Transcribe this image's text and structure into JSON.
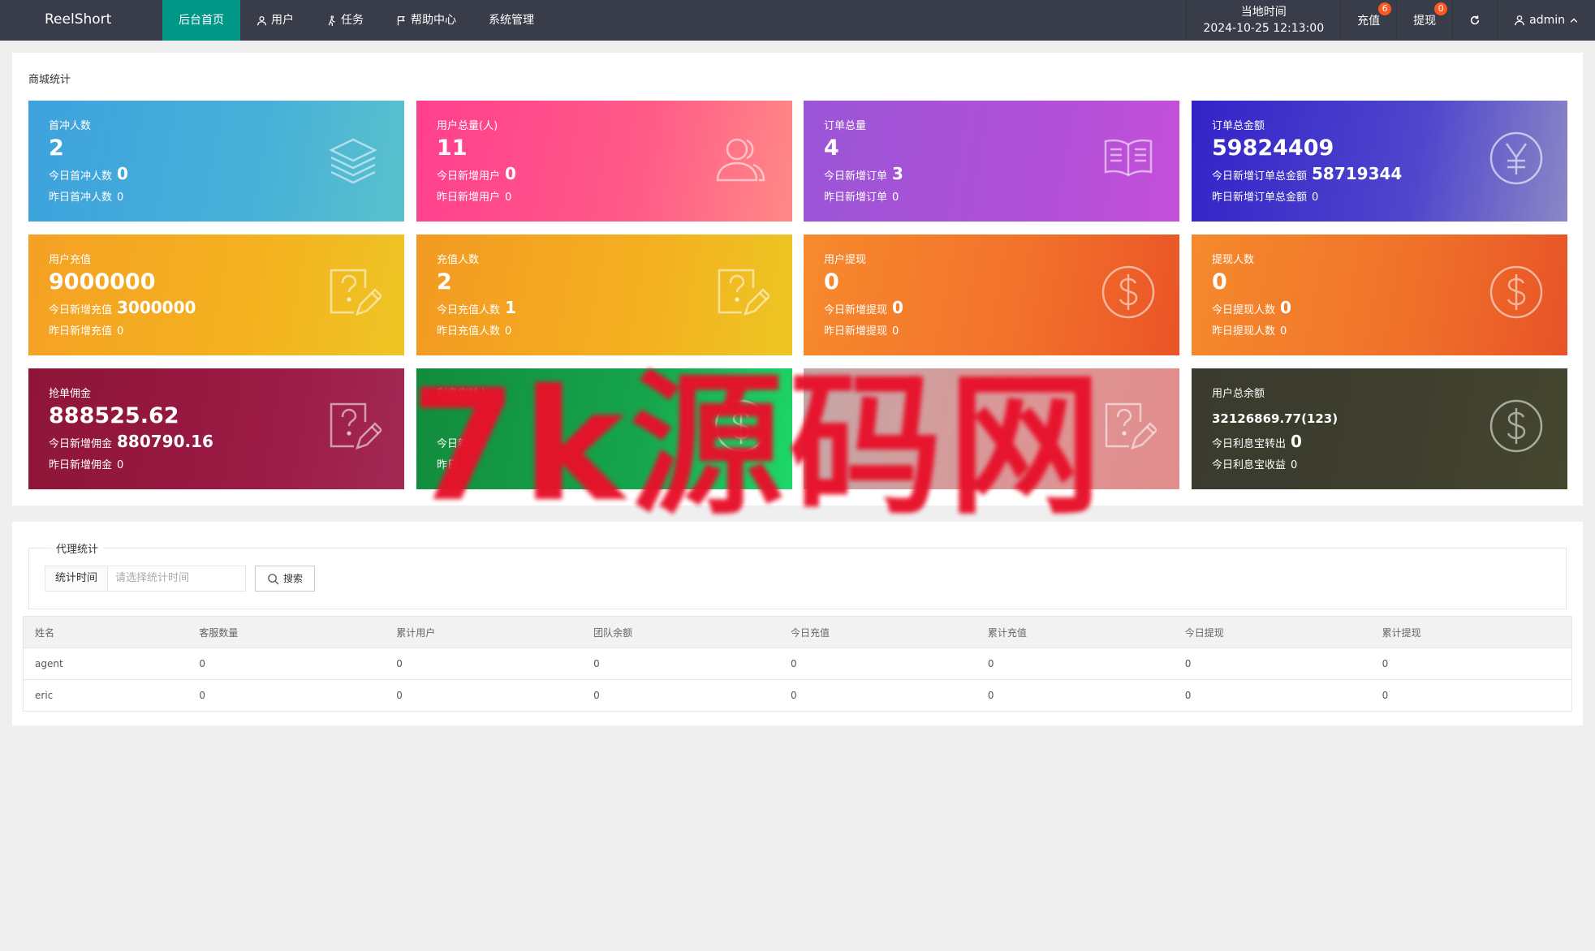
{
  "topbar": {
    "logo": "ReelShort",
    "nav": [
      "后台首页",
      "用户",
      "任务",
      "帮助中心",
      "系统管理"
    ],
    "time_label": "当地时间",
    "time_value": "2024-10-25 12:13:00",
    "recharge": "充值",
    "recharge_badge": "6",
    "withdraw": "提现",
    "withdraw_badge": "0",
    "user": "admin"
  },
  "stats": {
    "title": "商城统计",
    "cards": [
      {
        "label": "首冲人数",
        "value": "2",
        "line2_label": "今日首冲人数",
        "line2_value": "0",
        "line3_label": "昨日首冲人数",
        "line3_value": "0",
        "icon": "layers-icon"
      },
      {
        "label": "用户总量(人)",
        "value": "11",
        "line2_label": "今日新增用户",
        "line2_value": "0",
        "line3_label": "昨日新增用户",
        "line3_value": "0",
        "icon": "users-icon"
      },
      {
        "label": "订单总量",
        "value": "4",
        "line2_label": "今日新增订单",
        "line2_value": "3",
        "line3_label": "昨日新增订单",
        "line3_value": "0",
        "icon": "book-icon"
      },
      {
        "label": "订单总金额",
        "value": "59824409",
        "line2_label": "今日新增订单总金额",
        "line2_value": "58719344",
        "line3_label": "昨日新增订单总金额",
        "line3_value": "0",
        "icon": "yen-icon"
      },
      {
        "label": "用户充值",
        "value": "9000000",
        "line2_label": "今日新增充值",
        "line2_value": "3000000",
        "line3_label": "昨日新增充值",
        "line3_value": "0",
        "icon": "edit-question-icon"
      },
      {
        "label": "充值人数",
        "value": "2",
        "line2_label": "今日充值人数",
        "line2_value": "1",
        "line3_label": "昨日充值人数",
        "line3_value": "0",
        "icon": "edit-question-icon"
      },
      {
        "label": "用户提现",
        "value": "0",
        "line2_label": "今日新增提现",
        "line2_value": "0",
        "line3_label": "昨日新增提现",
        "line3_value": "0",
        "icon": "dollar-icon"
      },
      {
        "label": "提现人数",
        "value": "0",
        "line2_label": "今日提现人数",
        "line2_value": "0",
        "line3_label": "昨日提现人数",
        "line3_value": "0",
        "icon": "dollar-icon"
      },
      {
        "label": "抢单佣金",
        "value": "888525.62",
        "line2_label": "今日新增佣金",
        "line2_value": "880790.16",
        "line3_label": "昨日新增佣金",
        "line3_value": "0",
        "icon": "edit-question-icon"
      },
      {
        "label": "利息宝转入",
        "value": "",
        "line2_label": "今日新",
        "line2_value": "",
        "line3_label": "昨日",
        "line3_value": "",
        "icon": "dollar-icon"
      },
      {
        "label": "",
        "value": "",
        "line2_label": "",
        "line2_value": "",
        "line3_label": "",
        "line3_value": "",
        "icon": "edit-question-icon"
      },
      {
        "label": "用户总余额",
        "value": "32126869.77(123)",
        "line2_label": "今日利息宝转出",
        "line2_value": "0",
        "line3_label": "今日利息宝收益",
        "line3_value": "0",
        "icon": "dollar-icon"
      }
    ]
  },
  "watermark": "7k源码网",
  "agent": {
    "legend": "代理统计",
    "field_label": "统计时间",
    "field_placeholder": "请选择统计时间",
    "search_btn": "搜索",
    "columns": [
      "姓名",
      "客服数量",
      "累计用户",
      "团队余额",
      "今日充值",
      "累计充值",
      "今日提现",
      "累计提现"
    ],
    "rows": [
      [
        "agent",
        "0",
        "0",
        "0",
        "0",
        "0",
        "0",
        "0"
      ],
      [
        "eric",
        "0",
        "0",
        "0",
        "0",
        "0",
        "0",
        "0"
      ]
    ]
  },
  "colors": {
    "topbar": "#393d49",
    "active_nav": "#009688",
    "badge": "#ff5722",
    "watermark": "#e8102a"
  }
}
